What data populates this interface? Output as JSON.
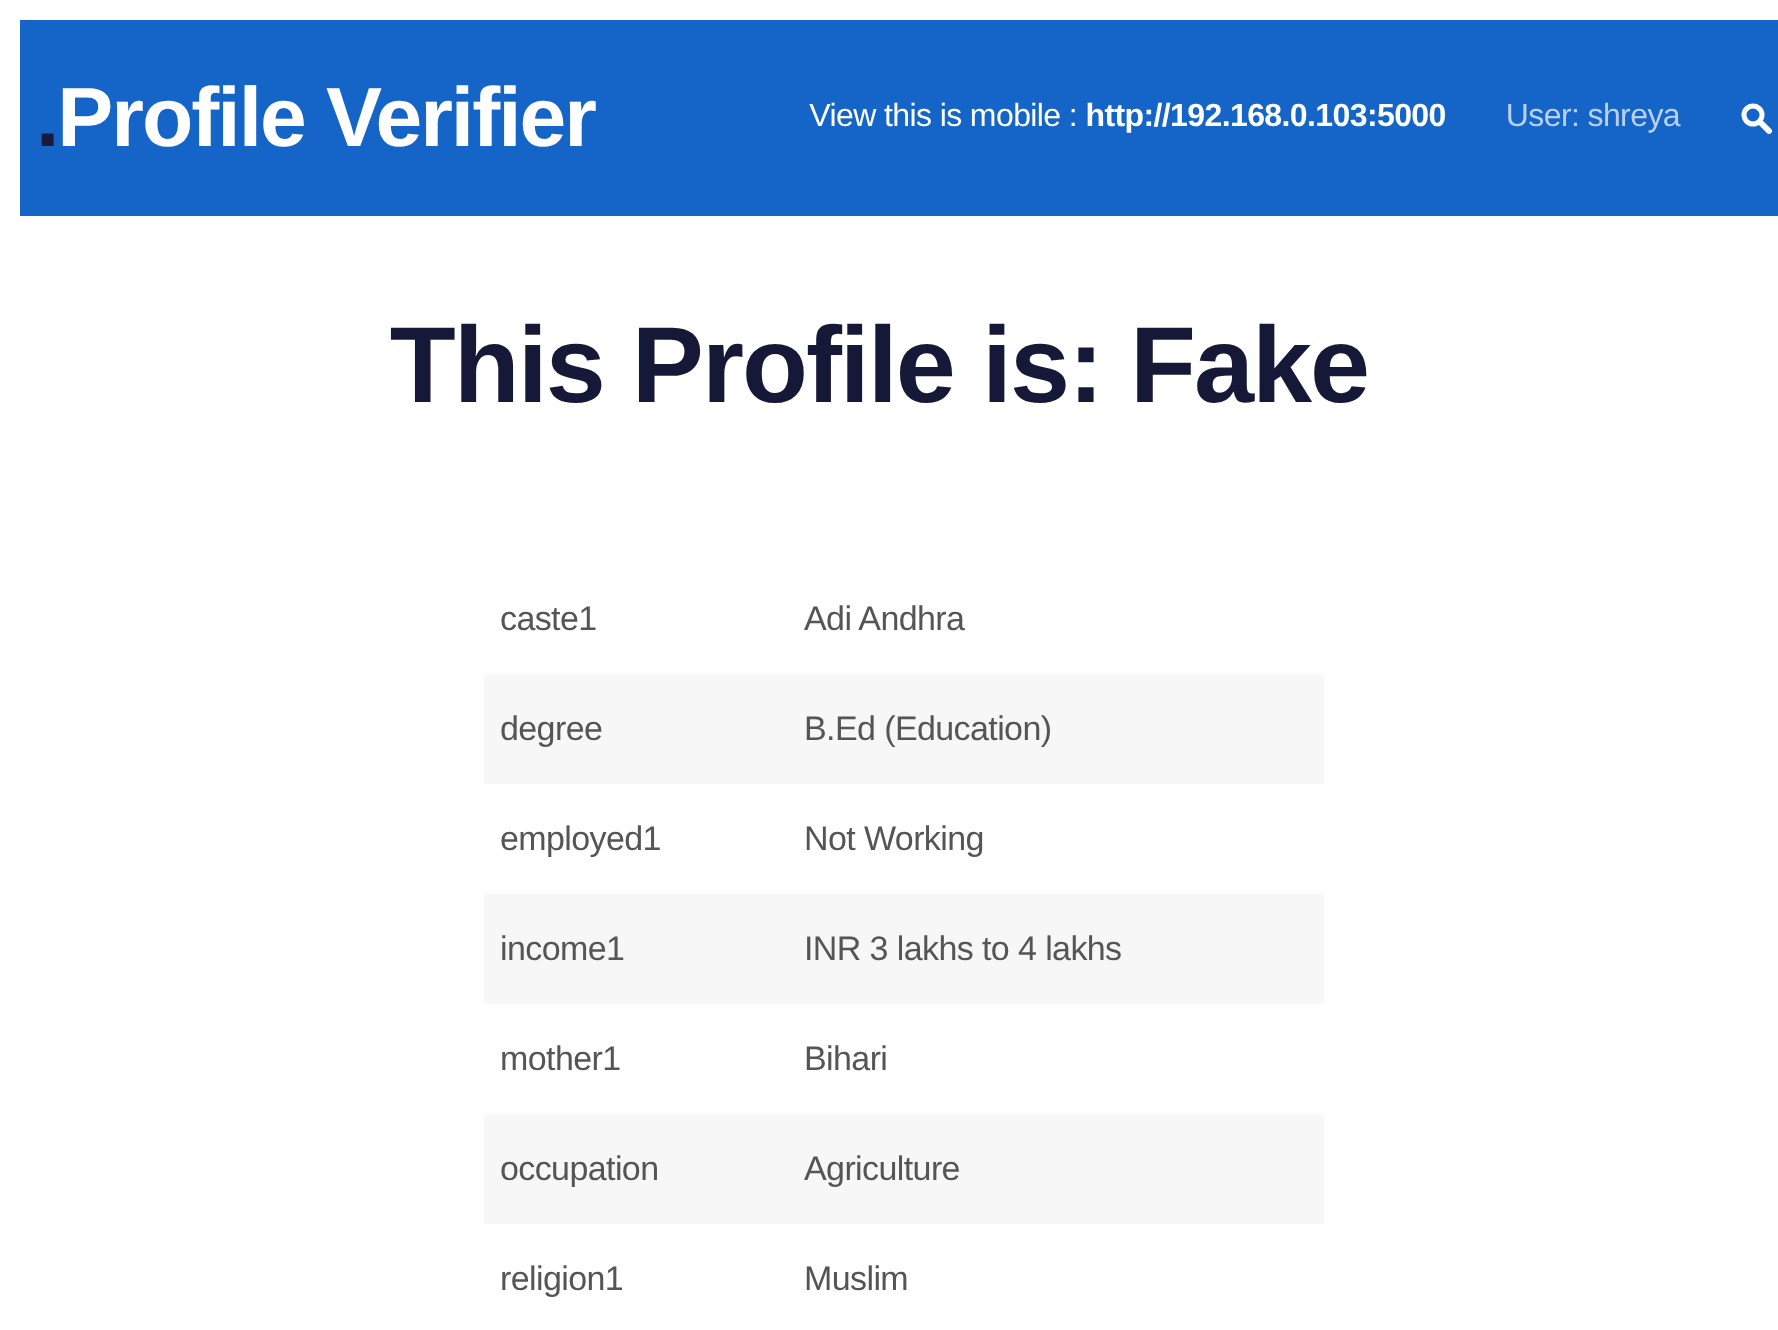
{
  "navbar": {
    "logo_dot": ".",
    "logo": "Profile Verifier",
    "mobile_link": "View this is mobile : **http://192.168.0.103:5000**",
    "user": "User: shreya"
  },
  "heading": "This Profile is: Fake",
  "table": {
    "rows": [
      {
        "field": "caste1",
        "value": "Adi Andhra"
      },
      {
        "field": "degree",
        "value": "B.Ed (Education)"
      },
      {
        "field": "employed1",
        "value": "Not Working"
      },
      {
        "field": "income1",
        "value": "INR 3 lakhs to 4 lakhs"
      },
      {
        "field": "mother1",
        "value": "Bihari"
      },
      {
        "field": "occupation",
        "value": "Agriculture"
      },
      {
        "field": "religion1",
        "value": "Muslim"
      }
    ]
  }
}
